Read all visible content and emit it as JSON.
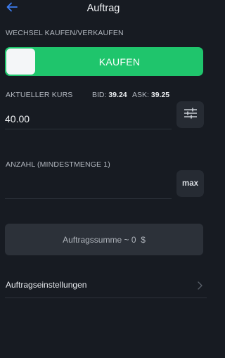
{
  "header": {
    "title": "Auftrag",
    "back_icon": "arrow-left-icon"
  },
  "trade_direction": {
    "section_label": "WECHSEL KAUFEN/VERKAUFEN",
    "toggle_label": "KAUFEN",
    "toggle_state": "buy",
    "toggle_color": "#1fc56c"
  },
  "price": {
    "label": "AKTUELLER KURS",
    "bid_label": "BID:",
    "bid_value": "39.24",
    "ask_label": "ASK:",
    "ask_value": "39.25",
    "value": "40.00",
    "adjust_icon": "sliders-icon"
  },
  "quantity": {
    "label": "ANZAHL (MINDESTMENGE 1)",
    "value": "",
    "max_label": "max"
  },
  "total": {
    "label": "Auftragssumme ~",
    "amount": "0",
    "currency": "$"
  },
  "settings": {
    "label": "Auftragseinstellungen",
    "chevron_icon": "chevron-right-icon"
  },
  "colors": {
    "accent_blue": "#3d7ef2",
    "buy_green": "#1fc56c",
    "background": "#171b22"
  }
}
